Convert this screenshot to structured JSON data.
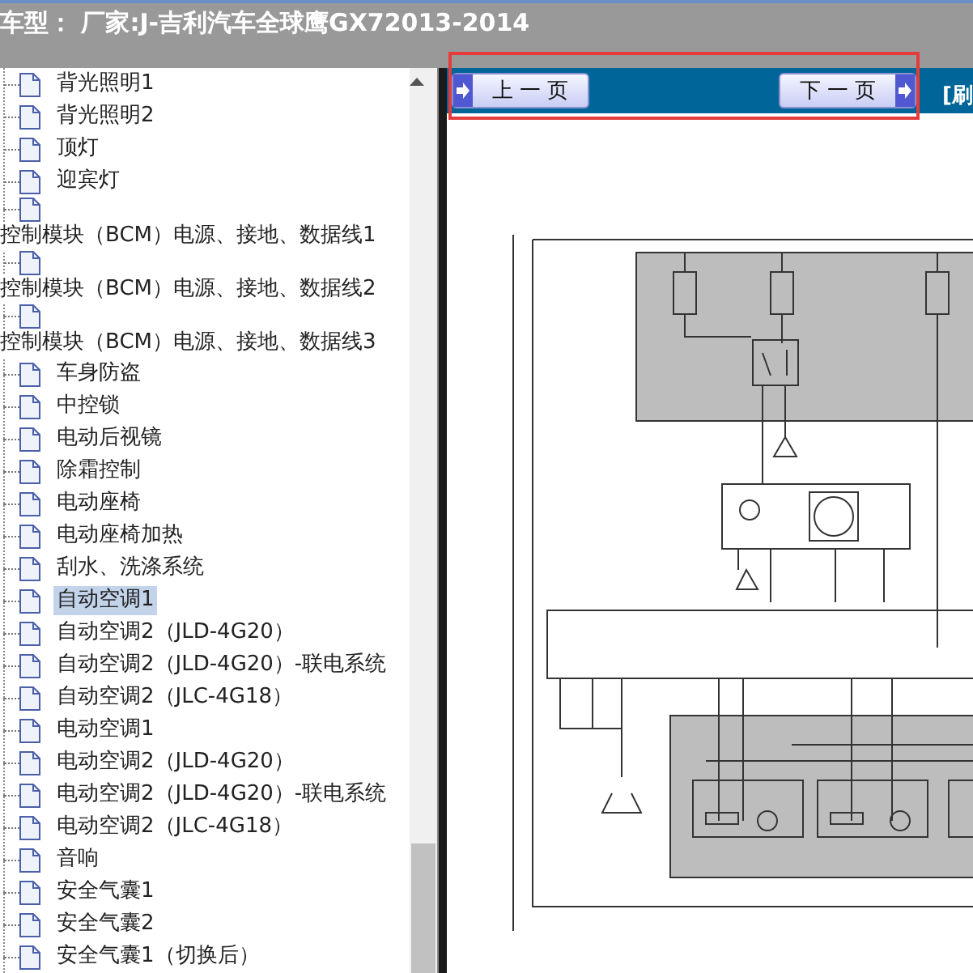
{
  "window": {
    "title": "车型： 厂家:J-吉利汽车全球鹰GX72013-2014"
  },
  "tree": {
    "items": [
      {
        "label": "背光照明1",
        "kind": "leaf",
        "selected": false
      },
      {
        "label": "背光照明2",
        "kind": "leaf",
        "selected": false
      },
      {
        "label": "顶灯",
        "kind": "leaf",
        "selected": false
      },
      {
        "label": "迎宾灯",
        "kind": "leaf",
        "selected": false
      },
      {
        "label": "控制模块（BCM）电源、接地、数据线1",
        "kind": "wrapped",
        "selected": false
      },
      {
        "label": "控制模块（BCM）电源、接地、数据线2",
        "kind": "wrapped",
        "selected": false
      },
      {
        "label": "控制模块（BCM）电源、接地、数据线3",
        "kind": "wrapped",
        "selected": false
      },
      {
        "label": "车身防盗",
        "kind": "leaf",
        "selected": false
      },
      {
        "label": "中控锁",
        "kind": "leaf",
        "selected": false
      },
      {
        "label": "电动后视镜",
        "kind": "leaf",
        "selected": false
      },
      {
        "label": "除霜控制",
        "kind": "leaf",
        "selected": false
      },
      {
        "label": "电动座椅",
        "kind": "leaf",
        "selected": false
      },
      {
        "label": "电动座椅加热",
        "kind": "leaf",
        "selected": false
      },
      {
        "label": "刮水、洗涤系统",
        "kind": "leaf",
        "selected": false
      },
      {
        "label": "自动空调1",
        "kind": "leaf",
        "selected": true
      },
      {
        "label": "自动空调2（JLD-4G20）",
        "kind": "leaf",
        "selected": false
      },
      {
        "label": "自动空调2（JLD-4G20）-联电系统",
        "kind": "leaf",
        "selected": false
      },
      {
        "label": "自动空调2（JLC-4G18）",
        "kind": "leaf",
        "selected": false
      },
      {
        "label": "电动空调1",
        "kind": "leaf",
        "selected": false
      },
      {
        "label": "电动空调2（JLD-4G20）",
        "kind": "leaf",
        "selected": false
      },
      {
        "label": "电动空调2（JLD-4G20）-联电系统",
        "kind": "leaf",
        "selected": false
      },
      {
        "label": "电动空调2（JLC-4G18）",
        "kind": "leaf",
        "selected": false
      },
      {
        "label": "音响",
        "kind": "leaf",
        "selected": false
      },
      {
        "label": "安全气囊1",
        "kind": "leaf",
        "selected": false
      },
      {
        "label": "安全气囊2",
        "kind": "leaf",
        "selected": false
      },
      {
        "label": "安全气囊1（切换后）",
        "kind": "leaf",
        "selected": false
      }
    ]
  },
  "toolbar": {
    "prev_button": "上一页",
    "next_button": "下一页",
    "refresh_link": "[刷"
  }
}
